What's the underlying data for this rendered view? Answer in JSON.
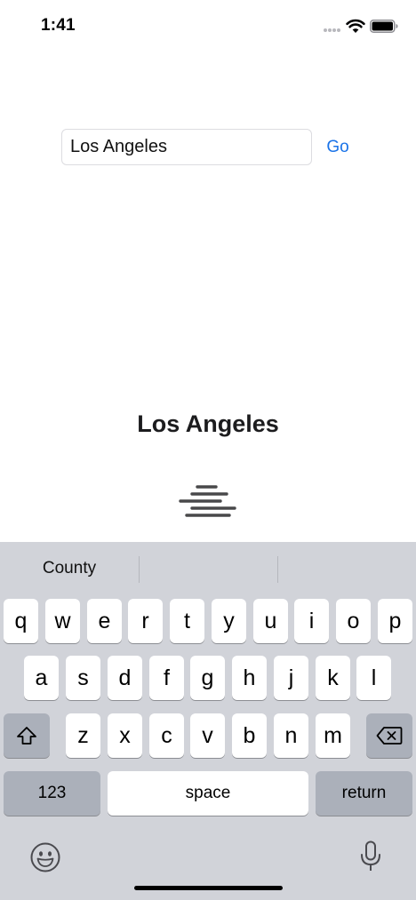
{
  "status_bar": {
    "time": "1:41"
  },
  "search": {
    "value": "Los Angeles",
    "go_label": "Go"
  },
  "result": {
    "city": "Los Angeles",
    "condition_icon": "fog-icon"
  },
  "keyboard": {
    "suggestions": [
      "County",
      "",
      ""
    ],
    "row1": [
      "q",
      "w",
      "e",
      "r",
      "t",
      "y",
      "u",
      "i",
      "o",
      "p"
    ],
    "row2": [
      "a",
      "s",
      "d",
      "f",
      "g",
      "h",
      "j",
      "k",
      "l"
    ],
    "row3": [
      "z",
      "x",
      "c",
      "v",
      "b",
      "n",
      "m"
    ],
    "numbers_label": "123",
    "space_label": "space",
    "return_label": "return",
    "shift_icon": "shift-icon",
    "delete_icon": "delete-icon",
    "emoji_icon": "emoji-icon",
    "mic_icon": "microphone-icon"
  },
  "colors": {
    "accent": "#1a73e8",
    "keyboard_bg": "#d1d3d9",
    "dark_key": "#abb0ba"
  }
}
